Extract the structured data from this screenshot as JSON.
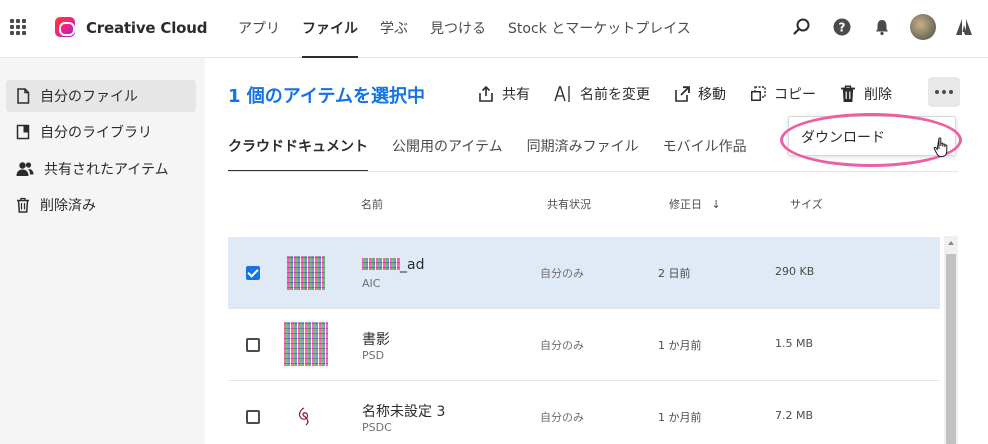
{
  "brand": {
    "name": "Creative Cloud"
  },
  "nav": [
    {
      "label": "アプリ"
    },
    {
      "label": "ファイル"
    },
    {
      "label": "学ぶ"
    },
    {
      "label": "見つける"
    },
    {
      "label": "Stock とマーケットプレイス"
    }
  ],
  "nav_active": "ファイル",
  "sidebar": {
    "items": [
      {
        "label": "自分のファイル",
        "icon": "file-icon"
      },
      {
        "label": "自分のライブラリ",
        "icon": "library-icon"
      },
      {
        "label": "共有されたアイテム",
        "icon": "people-icon"
      },
      {
        "label": "削除済み",
        "icon": "trash-icon"
      }
    ]
  },
  "toolbar": {
    "selected_title": "1 個のアイテムを選択中",
    "share_label": "共有",
    "rename_label": "名前を変更",
    "move_label": "移動",
    "copy_label": "コピー",
    "delete_label": "削除"
  },
  "dropdown": {
    "download_label": "ダウンロード"
  },
  "tabs": [
    {
      "label": "クラウドドキュメント"
    },
    {
      "label": "公開用のアイテム"
    },
    {
      "label": "同期済みファイル"
    },
    {
      "label": "モバイル作品"
    }
  ],
  "table": {
    "headers": {
      "name": "名前",
      "share": "共有状況",
      "modified": "修正日",
      "size": "サイズ"
    },
    "sort_indicator": "↓",
    "rows": [
      {
        "name_suffix": "_ad",
        "type": "AIC",
        "share": "自分のみ",
        "modified": "2 日前",
        "size": "290 KB",
        "selected": true
      },
      {
        "name": "書影",
        "type": "PSD",
        "share": "自分のみ",
        "modified": "1 か月前",
        "size": "1.5 MB",
        "selected": false
      },
      {
        "name": "名称未設定 3",
        "type": "PSDC",
        "share": "自分のみ",
        "modified": "1 か月前",
        "size": "7.2 MB",
        "selected": false
      }
    ]
  },
  "colors": {
    "accent": "#1473e6",
    "highlight": "#ec5fa4",
    "selected_row": "#dfeaf6"
  }
}
